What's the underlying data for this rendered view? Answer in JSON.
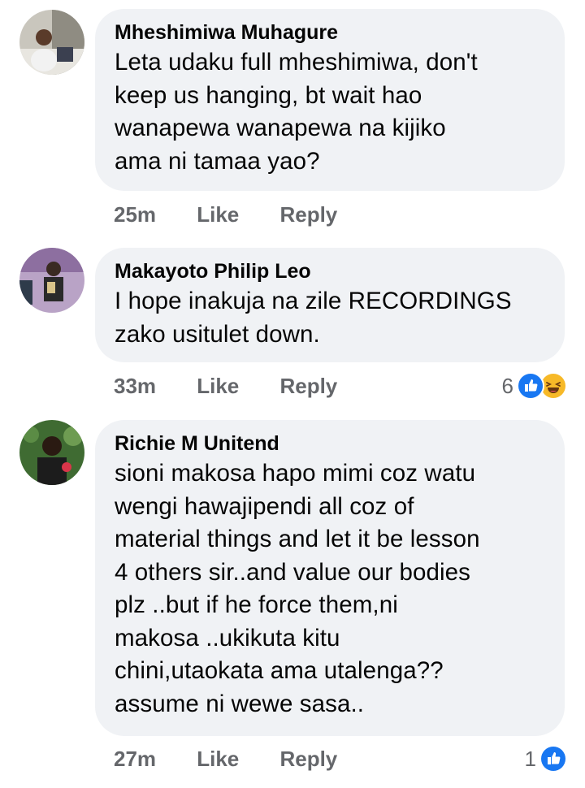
{
  "comments": [
    {
      "author": "Mheshimiwa Muhagure",
      "text": "Leta udaku full mheshimiwa, don't keep us hanging, bt wait hao wanapewa wanapewa na kijiko ama ni tamaa yao?",
      "lines": [
        "Leta udaku full mheshimiwa, don't",
        "keep us hanging, bt wait hao",
        "wanapewa wanapewa na kijiko",
        "ama ni tamaa yao?"
      ],
      "time": "25m",
      "like": "Like",
      "reply": "Reply",
      "reaction_count": "",
      "reactions": []
    },
    {
      "author": "Makayoto Philip Leo",
      "text": "I hope inakuja na zile RECORDINGS zako usitulet down.",
      "lines": [
        "I hope inakuja na zile RECORDINGS",
        "zako usitulet down."
      ],
      "time": "33m",
      "like": "Like",
      "reply": "Reply",
      "reaction_count": "6",
      "reactions": [
        "like-icon",
        "haha-icon"
      ]
    },
    {
      "author": "Richie M Unitend",
      "text": "sioni makosa hapo mimi coz watu wengi hawajipendi all coz of material things and let it be lesson 4 others sir..and value our bodies plz ..but if he force them,ni makosa ..ukikuta kitu chini,utaokata ama utalenga?? assume ni wewe sasa..",
      "lines": [
        "sioni makosa hapo mimi coz watu",
        "wengi hawajipendi all coz of",
        "material things and let it be lesson",
        "4 others sir..and value our bodies",
        "plz ..but if he force them,ni",
        "makosa ..ukikuta kitu",
        "chini,utaokata ama utalenga??",
        "assume ni wewe sasa.."
      ],
      "time": "27m",
      "like": "Like",
      "reply": "Reply",
      "reaction_count": "1",
      "reactions": [
        "like-icon"
      ]
    }
  ],
  "colors": {
    "bubble": "#f0f2f5",
    "meta": "#65676b",
    "like_blue": "#1877f2",
    "haha_yellow": "#f7b928"
  }
}
